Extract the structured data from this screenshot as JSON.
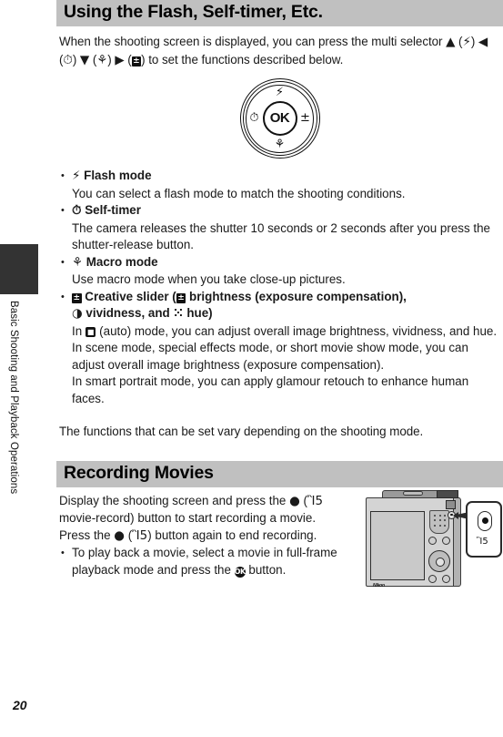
{
  "chapter": {
    "tab_label": "Basic Shooting and Playback Operations"
  },
  "page": {
    "number": "20"
  },
  "section1": {
    "heading": "Using the Flash, Self-timer, Etc.",
    "intro_before": "When the shooting screen is displayed, you can press the multi selector ",
    "intro_up": "▲",
    "intro_flash": "(⚡)",
    "intro_left": "◀",
    "intro_timer": "(⏱)",
    "intro_down": "▼",
    "intro_macro": "(⚘)",
    "intro_right": "▶",
    "intro_expo": "±",
    "intro_after": ") to set the functions described below.",
    "selector": {
      "ok_label": "OK",
      "flash_icon": "⚡",
      "timer_icon": "⏱",
      "expo_icon": "±",
      "macro_icon": "⚘"
    },
    "items": [
      {
        "icon": "⚡",
        "title": "Flash mode",
        "body": "You can select a flash mode to match the shooting conditions."
      },
      {
        "icon": "⏱",
        "title": "Self-timer",
        "body": "The camera releases the shutter 10 seconds or 2 seconds after you press the shutter-release button."
      },
      {
        "icon": "⚘",
        "title": "Macro mode",
        "body": "Use macro mode when you take close-up pictures."
      }
    ],
    "creative": {
      "icon": "±",
      "title_a": "Creative slider (",
      "expo_icon": "±",
      "title_b": " brightness (exposure compensation),",
      "vivid_icon": "◑",
      "title_c": " vividness, and ",
      "hue_icon": "⁙",
      "title_d": " hue)",
      "body_line1_a": "In ",
      "body_camera_icon": "■",
      "body_line1_b": " (auto) mode, you can adjust overall image brightness, vividness, and hue.",
      "body_line2": "In scene mode, special effects mode, or short movie show mode, you can adjust overall image brightness (exposure compensation).",
      "body_line3": "In smart portrait mode, you can apply glamour retouch to enhance human faces."
    },
    "tail": "The functions that can be set vary depending on the shooting mode."
  },
  "section2": {
    "heading": "Recording Movies",
    "body_a": "Display the shooting screen and press the ",
    "record_dot": "●",
    "body_b": " (",
    "movie_icon": "Ἲ5",
    "body_c": " movie-record) button to start recording a movie. Press the ",
    "body_d": " (",
    "body_e": ") button again to end recording.",
    "bullet_a": "To play back a movie, select a movie in full-frame playback mode and press the ",
    "ok_glyph": "OK",
    "bullet_b": " button."
  },
  "camera_figure": {
    "brand": "Nikon",
    "callout_icon": "Ἲ5"
  },
  "colors": {
    "section_bar": "#c0c0c0",
    "chapter_tab": "#333333",
    "text": "#1a1a1a"
  }
}
